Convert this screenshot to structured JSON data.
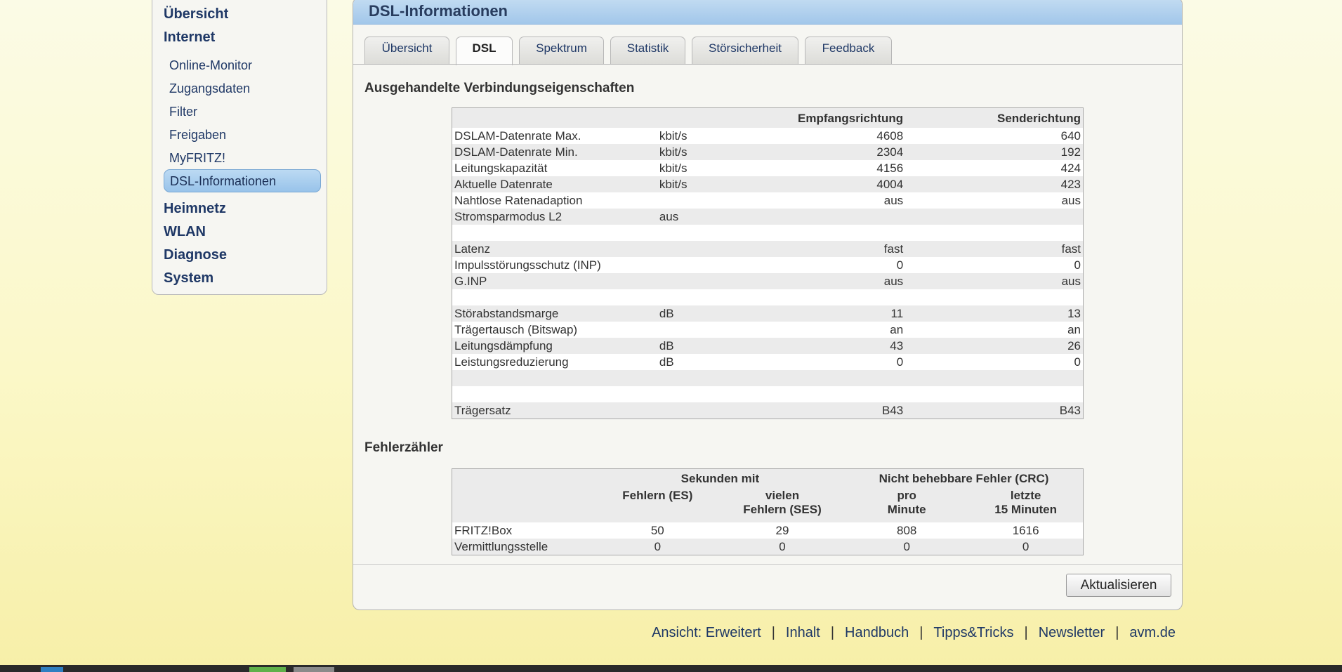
{
  "sidebar": {
    "main": [
      {
        "label": "Übersicht"
      },
      {
        "label": "Internet"
      },
      {
        "label": "Heimnetz"
      },
      {
        "label": "WLAN"
      },
      {
        "label": "Diagnose"
      },
      {
        "label": "System"
      }
    ],
    "internet_items": [
      {
        "label": "Online-Monitor"
      },
      {
        "label": "Zugangsdaten"
      },
      {
        "label": "Filter"
      },
      {
        "label": "Freigaben"
      },
      {
        "label": "MyFRITZ!"
      },
      {
        "label": "DSL-Informationen",
        "active": true
      }
    ]
  },
  "page": {
    "title": "DSL-Informationen",
    "tabs": [
      {
        "label": "Übersicht"
      },
      {
        "label": "DSL",
        "active": true
      },
      {
        "label": "Spektrum"
      },
      {
        "label": "Statistik"
      },
      {
        "label": "Störsicherheit"
      },
      {
        "label": "Feedback"
      }
    ]
  },
  "connection": {
    "heading": "Ausgehandelte Verbindungseigenschaften",
    "col_down": "Empfangsrichtung",
    "col_up": "Senderichtung",
    "rows": [
      {
        "label": "DSLAM-Datenrate Max.",
        "unit": "kbit/s",
        "down": "4608",
        "up": "640"
      },
      {
        "label": "DSLAM-Datenrate Min.",
        "unit": "kbit/s",
        "down": "2304",
        "up": "192"
      },
      {
        "label": "Leitungskapazität",
        "unit": "kbit/s",
        "down": "4156",
        "up": "424"
      },
      {
        "label": "Aktuelle Datenrate",
        "unit": "kbit/s",
        "down": "4004",
        "up": "423"
      },
      {
        "label": "Nahtlose Ratenadaption",
        "unit": "",
        "down": "aus",
        "up": "aus"
      },
      {
        "label": "Stromsparmodus L2",
        "unit": "aus",
        "down": "",
        "up": ""
      },
      {
        "label": "",
        "unit": "",
        "down": "",
        "up": ""
      },
      {
        "label": "Latenz",
        "unit": "",
        "down": "fast",
        "up": "fast"
      },
      {
        "label": "Impulsstörungsschutz (INP)",
        "unit": "",
        "down": "0",
        "up": "0"
      },
      {
        "label": "G.INP",
        "unit": "",
        "down": "aus",
        "up": "aus"
      },
      {
        "label": "",
        "unit": "",
        "down": "",
        "up": ""
      },
      {
        "label": "Störabstandsmarge",
        "unit": "dB",
        "down": "11",
        "up": "13"
      },
      {
        "label": "Trägertausch (Bitswap)",
        "unit": "",
        "down": "an",
        "up": "an"
      },
      {
        "label": "Leitungsdämpfung",
        "unit": "dB",
        "down": "43",
        "up": "26"
      },
      {
        "label": "Leistungsreduzierung",
        "unit": "dB",
        "down": "0",
        "up": "0"
      },
      {
        "label": "",
        "unit": "",
        "down": "",
        "up": ""
      },
      {
        "label": "",
        "unit": "",
        "down": "",
        "up": ""
      },
      {
        "label": "Trägersatz",
        "unit": "",
        "down": "B43",
        "up": "B43"
      }
    ]
  },
  "errors": {
    "heading": "Fehlerzähler",
    "group_seconds": "Sekunden mit",
    "group_crc": "Nicht behebbare Fehler (CRC)",
    "col_es": "Fehlern (ES)",
    "col_ses_1": "vielen",
    "col_ses_2": "Fehlern (SES)",
    "col_pm_1": "pro",
    "col_pm_2": "Minute",
    "col_15_1": "letzte",
    "col_15_2": "15 Minuten",
    "rows": [
      {
        "label": "FRITZ!Box",
        "es": "50",
        "ses": "29",
        "crc_min": "808",
        "crc_15": "1616"
      },
      {
        "label": "Vermittlungsstelle",
        "es": "0",
        "ses": "0",
        "crc_min": "0",
        "crc_15": "0"
      }
    ]
  },
  "actions": {
    "refresh_label": "Aktualisieren"
  },
  "footer": {
    "view_label": "Ansicht: Erweitert",
    "links": [
      "Inhalt",
      "Handbuch",
      "Tipps&Tricks",
      "Newsletter",
      "avm.de"
    ],
    "separator": "|"
  },
  "colors": {
    "accent": "#a2c7ea",
    "link": "#1f3866",
    "background": "#fbf8c8"
  }
}
